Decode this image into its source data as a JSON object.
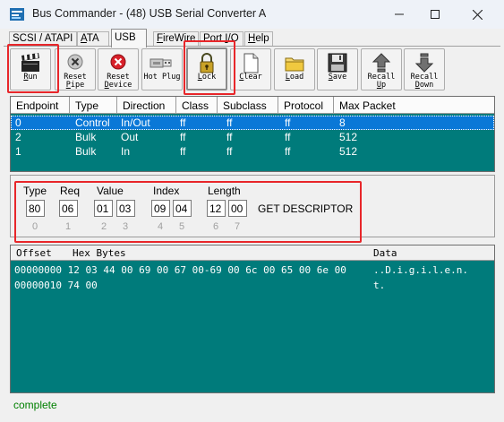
{
  "window": {
    "title": "Bus Commander - (48) USB Serial Converter A"
  },
  "tabs": [
    {
      "pre": "SCSI / ATAPI",
      "u": "",
      "post": ""
    },
    {
      "pre": "",
      "u": "A",
      "post": "TA"
    },
    {
      "pre": "USB",
      "u": "",
      "post": ""
    },
    {
      "pre": "",
      "u": "F",
      "post": "ireWire"
    },
    {
      "pre": "Port ",
      "u": "I",
      "post": "/O"
    },
    {
      "pre": "",
      "u": "H",
      "post": "elp"
    }
  ],
  "toolbar": {
    "run": {
      "u": "R",
      "rest": "un"
    },
    "reset_pipe": {
      "line1": "Reset",
      "line2u": "P",
      "line2": "ipe"
    },
    "reset_device": {
      "line1": "Reset",
      "line2u": "D",
      "line2": "evice"
    },
    "hot_plug": {
      "label": "Hot Plug"
    },
    "lock": {
      "u": "L",
      "rest": "ock"
    },
    "clear": {
      "u": "C",
      "rest": "lear"
    },
    "load": {
      "u": "L",
      "rest": "oad"
    },
    "save": {
      "u": "S",
      "rest": "ave"
    },
    "recall_up": {
      "line1": "Recall",
      "line2u": "U",
      "line2": "p"
    },
    "recall_down": {
      "line1": "Recall",
      "line2u": "D",
      "line2": "own"
    }
  },
  "endpoints": {
    "headers": [
      "Endpoint",
      "Type",
      "Direction",
      "Class",
      "Subclass",
      "Protocol",
      "Max Packet"
    ],
    "rows": [
      [
        "0",
        "Control",
        "In/Out",
        "ff",
        "ff",
        "ff",
        "8"
      ],
      [
        "2",
        "Bulk",
        "Out",
        "ff",
        "ff",
        "ff",
        "512"
      ],
      [
        "1",
        "Bulk",
        "In",
        "ff",
        "ff",
        "ff",
        "512"
      ]
    ]
  },
  "setup": {
    "labels": {
      "type": "Type",
      "req": "Req",
      "value": "Value",
      "index": "Index",
      "length": "Length"
    },
    "bytes": [
      "80",
      "06",
      "01",
      "03",
      "09",
      "04",
      "12",
      "00"
    ],
    "indices": [
      "0",
      "1",
      "2",
      "3",
      "4",
      "5",
      "6",
      "7"
    ],
    "request_name": "GET DESCRIPTOR"
  },
  "data": {
    "headers": {
      "offset": "Offset",
      "hex": "Hex Bytes",
      "ascii": "Data"
    },
    "lines": [
      {
        "hex": "00000000 12 03 44 00 69 00 67 00-69 00 6c 00 65 00 6e 00",
        "ascii": "..D.i.g.i.l.e.n."
      },
      {
        "hex": "00000010 74 00",
        "ascii": "t."
      }
    ]
  },
  "status": "complete",
  "colors": {
    "accent": "#e8262a",
    "teal": "#007b7b",
    "selection": "#0a78d7",
    "status": "#008000"
  }
}
